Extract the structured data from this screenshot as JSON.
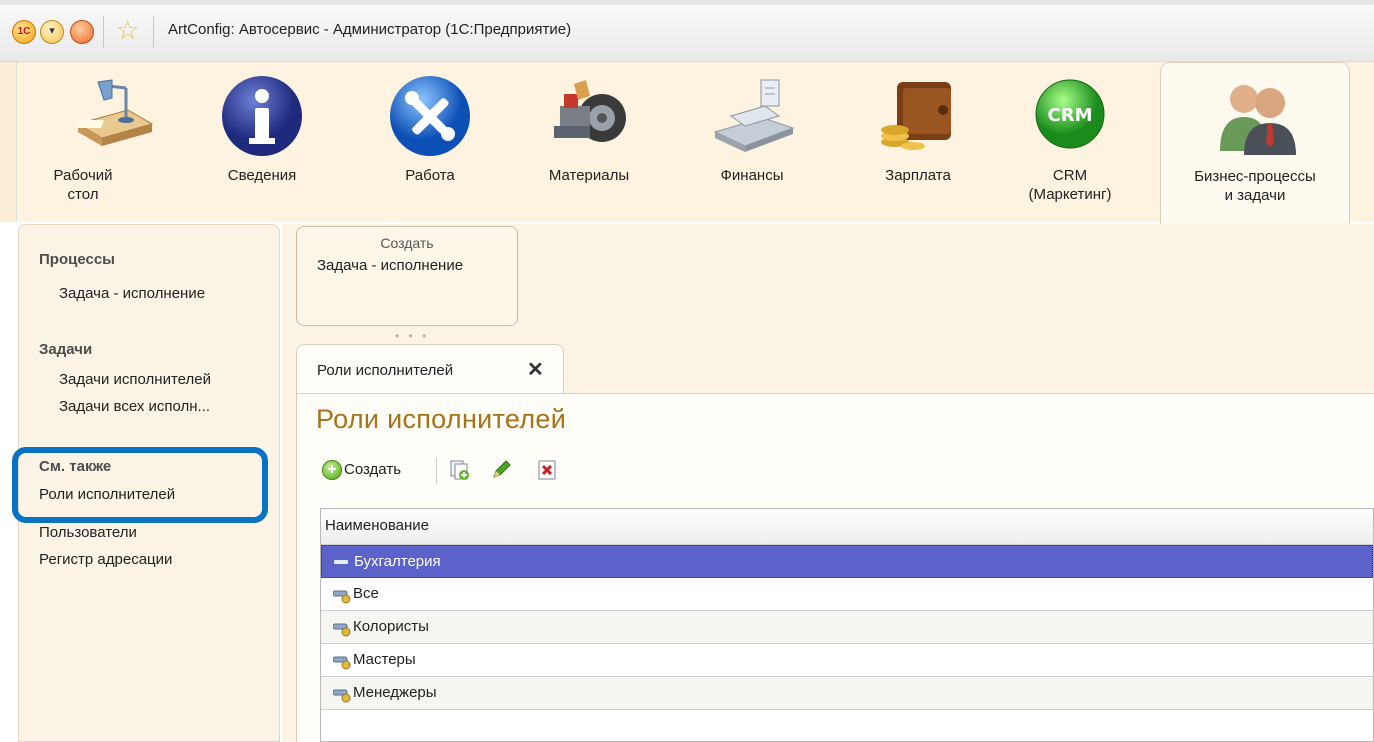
{
  "window": {
    "title": "ArtConfig: Автосервис - Администратор  (1С:Предприятие)"
  },
  "sections": [
    {
      "label": "Рабочий\nстол",
      "icon": "desk-lamp-icon"
    },
    {
      "label": "Сведения",
      "icon": "info-icon"
    },
    {
      "label": "Работа",
      "icon": "tools-icon"
    },
    {
      "label": "Материалы",
      "icon": "materials-icon"
    },
    {
      "label": "Финансы",
      "icon": "cash-register-icon"
    },
    {
      "label": "Зарплата",
      "icon": "wallet-coins-icon"
    },
    {
      "label": "CRM\n(Маркетинг)",
      "icon": "crm-icon"
    },
    {
      "label": "Бизнес-процессы\nи задачи",
      "icon": "business-people-icon"
    }
  ],
  "nav": {
    "processes_header": "Процессы",
    "processes_item": "Задача - исполнение",
    "tasks_header": "Задачи",
    "tasks_items": [
      "Задачи исполнителей",
      "Задачи всех исполн..."
    ],
    "see_also_header": "См. также",
    "see_also_items": [
      "Роли исполнителей",
      "Пользователи",
      "Регистр адресации"
    ]
  },
  "create_panel": {
    "caption": "Создать",
    "item": "Задача - исполнение"
  },
  "tab": {
    "label": "Роли исполнителей",
    "close": "✕"
  },
  "form": {
    "title": "Роли исполнителей",
    "toolbar": {
      "create_label": "Создать"
    },
    "table": {
      "column": "Наименование",
      "rows": [
        "Бухгалтерия",
        "Все",
        "Колористы",
        "Мастеры",
        "Менеджеры"
      ],
      "selected_row": "Бухгалтерия"
    }
  },
  "colors": {
    "selection": "#5b62c9",
    "highlight_frame": "#0872c4",
    "form_title": "#a6721a"
  }
}
